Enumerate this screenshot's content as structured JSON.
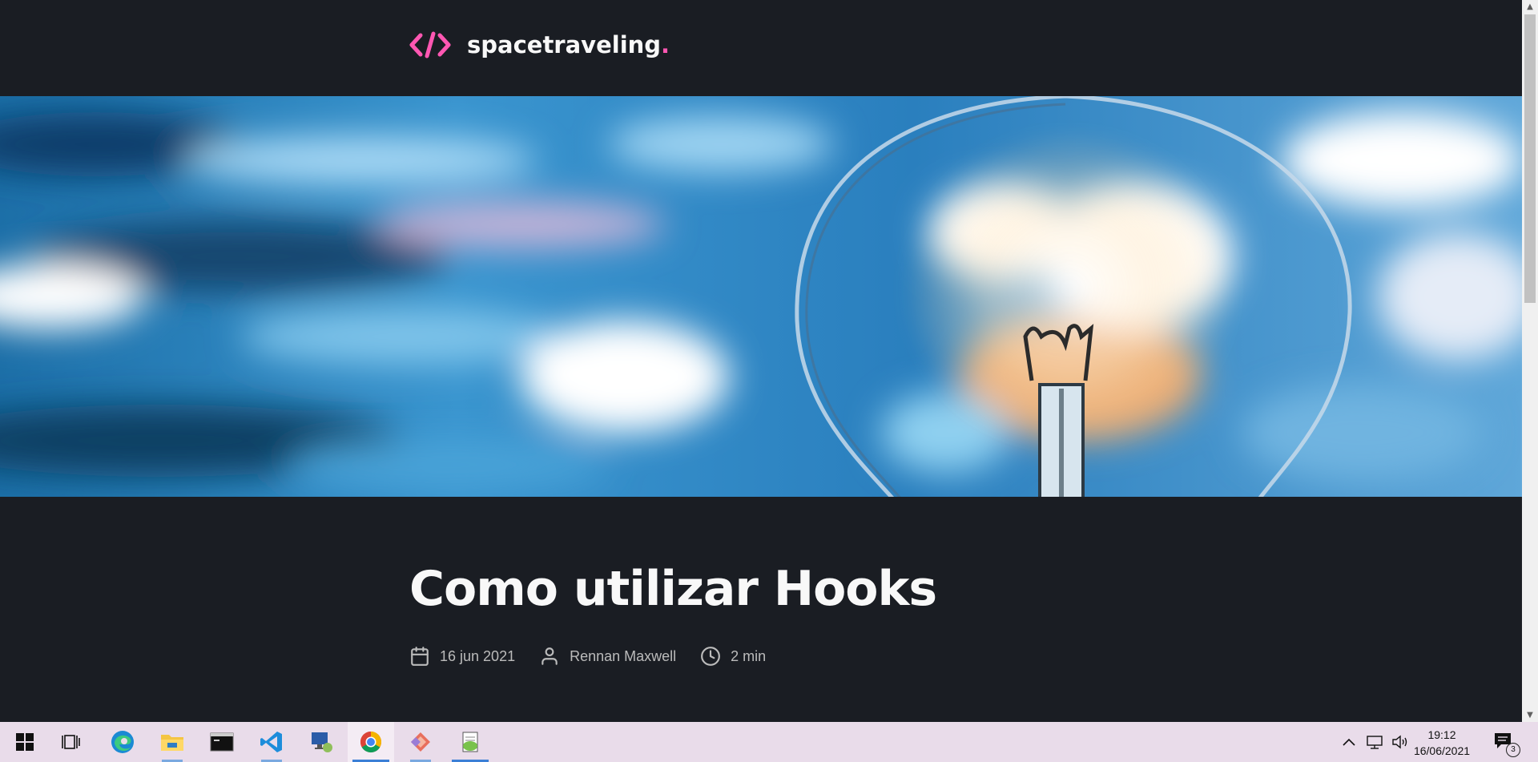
{
  "header": {
    "logo_icon": "code-brackets-icon",
    "site_name": "spacetraveling",
    "site_dot": ".",
    "accent_color": "#ff57b2"
  },
  "banner": {
    "image": "light-bulb-blue-bokeh"
  },
  "post": {
    "title": "Como utilizar Hooks",
    "date": "16 jun 2021",
    "author": "Rennan Maxwell",
    "reading_time": "2 min",
    "date_icon": "calendar-icon",
    "author_icon": "user-icon",
    "time_icon": "clock-icon"
  },
  "scrollbar": {
    "up": "▲",
    "down": "▼"
  },
  "taskbar": {
    "apps": [
      {
        "name": "start-button",
        "icon": "windows-icon"
      },
      {
        "name": "task-view-button",
        "icon": "task-view-icon"
      },
      {
        "name": "edge-button",
        "icon": "edge-icon"
      },
      {
        "name": "file-explorer-button",
        "icon": "folder-icon"
      },
      {
        "name": "terminal-button",
        "icon": "terminal-icon"
      },
      {
        "name": "vscode-button",
        "icon": "vscode-icon"
      },
      {
        "name": "remote-desktop-button",
        "icon": "remote-desktop-icon"
      },
      {
        "name": "chrome-button",
        "icon": "chrome-icon"
      },
      {
        "name": "git-client-button",
        "icon": "git-icon"
      },
      {
        "name": "notepad-plus-button",
        "icon": "notepad-icon"
      }
    ],
    "time": "19:12",
    "date": "16/06/2021",
    "notification_count": "3"
  }
}
